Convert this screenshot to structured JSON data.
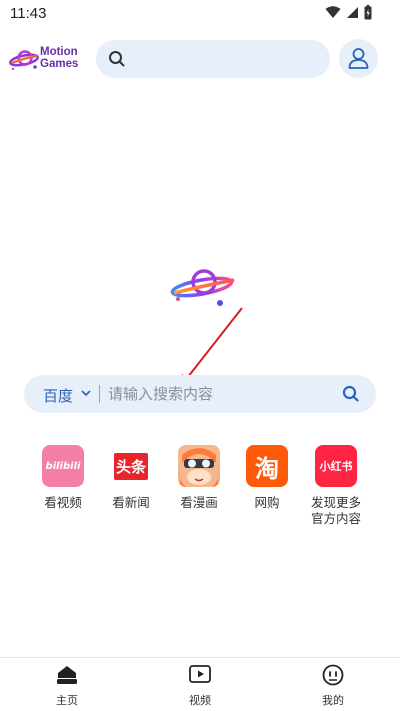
{
  "status_bar": {
    "time": "11:43"
  },
  "header": {
    "logo_line1": "Motion",
    "logo_line2": "Games"
  },
  "main_search": {
    "engine": "百度",
    "placeholder": "请输入搜索内容"
  },
  "shortcuts": [
    {
      "label": "看视频",
      "tile_text": "bilibili",
      "color": "#f47fa6"
    },
    {
      "label": "看新闻",
      "tile_text": "头条",
      "color": "#e8242d"
    },
    {
      "label": "看漫画",
      "tile_text": "",
      "color": "#f2a06b"
    },
    {
      "label": "网购",
      "tile_text": "淘",
      "color": "#ff5a0a"
    },
    {
      "label_line1": "发现更多",
      "label_line2": "官方内容",
      "tile_text": "小红书",
      "color": "#ff2442"
    }
  ],
  "bottom_nav": [
    {
      "label": "主页",
      "icon": "home-icon"
    },
    {
      "label": "视频",
      "icon": "video-icon"
    },
    {
      "label": "我的",
      "icon": "face-icon"
    }
  ],
  "colors": {
    "accent": "#2a63b8",
    "search_bg": "#e6effa",
    "annotation": "#d42020"
  }
}
